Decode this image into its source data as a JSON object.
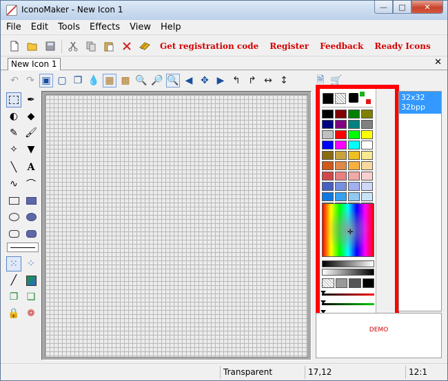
{
  "window": {
    "title": "IconoMaker - New Icon 1"
  },
  "window_controls": {
    "minimize": "—",
    "maximize": "□",
    "close": "✕"
  },
  "menu": [
    "File",
    "Edit",
    "Tools",
    "Effects",
    "View",
    "Help"
  ],
  "toolbar": {
    "icons": [
      "new-icon",
      "open-folder-icon",
      "save-icon",
      "cut-icon",
      "copy-icon",
      "paste-icon",
      "delete-icon",
      "register-key-icon"
    ],
    "links": {
      "get_code": "Get registration code",
      "register": "Register",
      "feedback": "Feedback",
      "ready_icons": "Ready Icons"
    },
    "link_color": "#d40000"
  },
  "doc": {
    "tab_label": "New Icon 1",
    "close": "✕"
  },
  "palette": {
    "swatches": [
      "#000000",
      "#800000",
      "#008000",
      "#808000",
      "#000080",
      "#800080",
      "#008080",
      "#808080",
      "#c0c0c0",
      "#ff0000",
      "#00ff00",
      "#ffff00",
      "#0000ff",
      "#ff00ff",
      "#00ffff",
      "#ffffff",
      "#8b6b10",
      "#c8a23c",
      "#f0c020",
      "#f8e890",
      "#d05818",
      "#e08848",
      "#f8b040",
      "#f8d8a0",
      "#d04848",
      "#e88080",
      "#f0a8a8",
      "#f8d0d0",
      "#4860c0",
      "#7890e0",
      "#a0b0f0",
      "#d0d8f8",
      "#1078e0",
      "#38a0f0",
      "#90c8f0",
      "#c8e4f8",
      "#108828",
      "#48b838",
      "#98d880",
      "#c8f0c0"
    ],
    "highlight_color": "#ff0000"
  },
  "formats": [
    "32x32",
    "32bpp"
  ],
  "preview": {
    "demo_label": "DEMO"
  },
  "status": {
    "color_text": "Transparent",
    "coords": "17,12",
    "zoom": "12:1"
  }
}
